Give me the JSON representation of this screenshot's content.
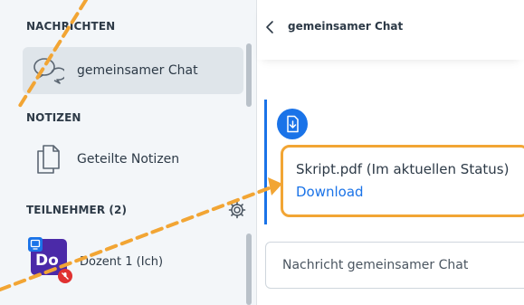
{
  "sidebar": {
    "messages_header": "NACHRICHTEN",
    "chat_item_label": "gemeinsamer Chat",
    "notes_header": "NOTIZEN",
    "notes_item_label": "Geteilte Notizen",
    "participants_header": "TEILNEHMER (2)",
    "user": {
      "initials": "Do",
      "label": "Dozent 1 (Ich)"
    }
  },
  "chat": {
    "title": "gemeinsamer Chat",
    "message": {
      "file_text": "Skript.pdf  (Im aktuellen Status)",
      "download_label": "Download"
    },
    "input_placeholder": "Nachricht gemeinsamer Chat"
  },
  "colors": {
    "accent": "#1a73e8",
    "highlight": "#f2a534",
    "avatar": "#4b2aa8",
    "mute": "#e03131"
  }
}
